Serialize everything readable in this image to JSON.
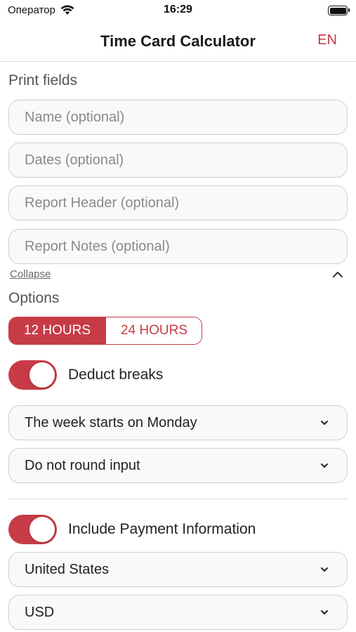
{
  "status_bar": {
    "carrier": "Оператор",
    "time": "16:29"
  },
  "header": {
    "title": "Time Card Calculator",
    "language": "EN"
  },
  "print_fields": {
    "section_title": "Print fields",
    "name_placeholder": "Name (optional)",
    "dates_placeholder": "Dates (optional)",
    "report_header_placeholder": "Report Header (optional)",
    "report_notes_placeholder": "Report Notes (optional)",
    "collapse_label": "Collapse"
  },
  "options": {
    "section_title": "Options",
    "hour_format": {
      "options": [
        "12 HOURS",
        "24 HOURS"
      ],
      "selected": "12 HOURS"
    },
    "deduct_breaks": {
      "label": "Deduct breaks",
      "enabled": true
    },
    "week_start": "The week starts on Monday",
    "rounding": "Do not round input"
  },
  "payment": {
    "include_payment": {
      "label": "Include Payment Information",
      "enabled": true
    },
    "country": "United States",
    "currency": "USD"
  },
  "colors": {
    "accent": "#c73b47",
    "field_border": "#cfcfcf",
    "field_bg": "#f9f9fa"
  }
}
